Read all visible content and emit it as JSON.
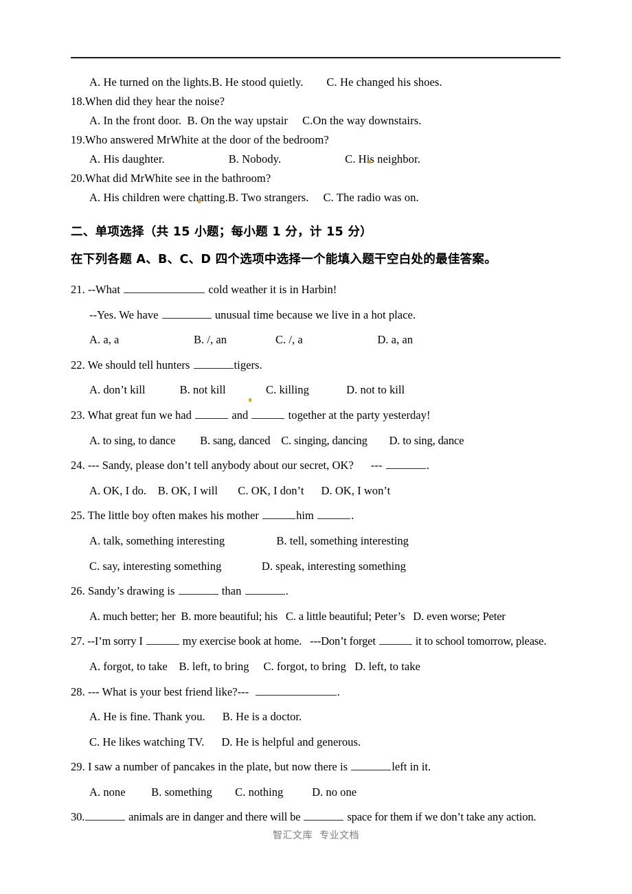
{
  "document": {
    "footer_text": "智汇文库  专业文档",
    "rule_color": "#1a1a1a"
  },
  "listening_section": {
    "lines": [
      {
        "id": "q17-options",
        "indent": true,
        "text": "A. He turned on the lights.B. He stood quietly.        C. He changed his shoes."
      },
      {
        "id": "q18-stem",
        "indent": false,
        "text": "18.When did they hear the noise?"
      },
      {
        "id": "q18-options",
        "indent": true,
        "text": "A. In the front door.  B. On the way upstair     C.On the way downstairs."
      },
      {
        "id": "q19-stem",
        "indent": false,
        "text": "19.Who answered MrWhite at the door of the bedroom?"
      },
      {
        "id": "q19-options",
        "indent": true,
        "text": "A. His daughter.                      B. Nobody.                      C. His neighbor."
      },
      {
        "id": "q20-stem",
        "indent": false,
        "text": "20.What did MrWhite see in the bathroom?"
      },
      {
        "id": "q20-options",
        "indent": true,
        "text": "A. His children were chatting.B. Two strangers.     C. The radio was on."
      }
    ]
  },
  "section_two": {
    "heading": "二、单项选择（共 15 小题；每小题 1 分，计 15 分）",
    "instruction": "在下列各题 A、B、C、D 四个选项中选择一个能填入题干空白处的最佳答案。"
  },
  "questions": [
    {
      "number": "21.",
      "stem_parts": [
        "21. --What ",
        "BLANK:b-xl",
        " cold weather it is in Harbin!"
      ],
      "stem2_parts": [
        "--Yes. We have ",
        "BLANK:b-lg",
        " unusual time because we live in a hot place."
      ],
      "options_text": "A. a, a                          B. /, an                 C. /, a                          D. a, an"
    },
    {
      "number": "22.",
      "stem_parts": [
        "22. We should tell hunters ",
        "BLANK:b-md",
        "tigers."
      ],
      "options_text": "A. don’t kill            B. not kill              C. killing             D. not to kill"
    },
    {
      "number": "23.",
      "stem_parts": [
        "23. What great fun we had ",
        "BLANK:b-sm",
        " and ",
        "BLANK:b-sm",
        " together at the party yesterday!"
      ],
      "options_text": "A. to sing, to dance         B. sang, danced    C. singing, dancing        D. to sing, dance"
    },
    {
      "number": "24.",
      "stem_parts": [
        "24. --- Sandy, please don’t tell anybody about our secret, OK?      --- ",
        "BLANK:b-md",
        "."
      ],
      "options_text": "A. OK, I do.    B. OK, I will       C. OK, I don’t      D. OK, I won’t"
    },
    {
      "number": "25.",
      "stem_parts": [
        "25. The little boy often makes his mother ",
        "BLANK:b-sm",
        "him ",
        "BLANK:b-sm",
        "."
      ],
      "options_text_a": "A. talk, something interesting                  B. tell, something interesting",
      "options_text_b": "C. say, interesting something              D. speak, interesting something"
    },
    {
      "number": "26.",
      "stem_parts": [
        "26. Sandy’s drawing is ",
        "BLANK:b-md",
        " than ",
        "BLANK:b-md",
        "."
      ],
      "options_text": "A. much better; her  B. more beautiful; his   C. a little beautiful; Peter’s   D. even worse; Peter"
    },
    {
      "number": "27.",
      "stem_parts": [
        "27. --I’m sorry I ",
        "BLANK:b-sm",
        " my exercise book at home.   ---Don’t forget ",
        "BLANK:b-sm",
        " it to school tomorrow, please."
      ],
      "options_text": "A. forgot, to take    B. left, to bring     C. forgot, to bring   D. left, to take"
    },
    {
      "number": "28.",
      "stem_parts": [
        "28. --- What is your best friend like?---  ",
        "BLANK:b-xl",
        "."
      ],
      "options_text_a": "A. He is fine. Thank you.      B. He is a doctor.",
      "options_text_b": "C. He likes watching TV.      D. He is helpful and generous."
    },
    {
      "number": "29.",
      "stem_parts": [
        "29. I saw a number of pancakes in the plate, but now there is ",
        "BLANK:b-md",
        "left in it."
      ],
      "options_text": "A. none         B. something        C. nothing          D. no one"
    },
    {
      "number": "30.",
      "stem_parts": [
        "30.",
        "BLANK:b-md",
        " animals are in danger and there will be ",
        "BLANK:b-md",
        " space for them if we don’t take any action."
      ],
      "options_text": ""
    }
  ]
}
